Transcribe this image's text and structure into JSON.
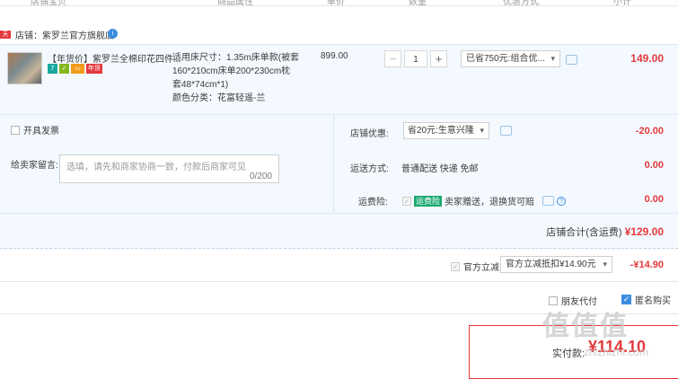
{
  "columns": [
    "店铺宝贝",
    "商品属性",
    "单价",
    "数量",
    "优惠方式",
    "小计"
  ],
  "shop": {
    "tag": "天猫",
    "label": "店铺：紫罗兰官方旗舰店",
    "badge": "i"
  },
  "item": {
    "title": "【年货价】紫罗兰全棉印花四件...",
    "icons": [
      "7",
      "✓",
      "▭",
      "年货"
    ],
    "spec_lines": [
      "适用床尺寸：1.35m床单款(被套",
      "160*210cm床单200*230cm枕",
      "套48*74cm*1)",
      "颜色分类：花富轻遥-兰"
    ],
    "unit_price": "899.00",
    "qty_minus": "−",
    "qty_value": "1",
    "qty_plus": "+",
    "promo": "已省750元:组合优...",
    "subtotal": "149.00"
  },
  "options": {
    "invoice_label": "开具发票",
    "message_label": "给卖家留言:",
    "message_placeholder": "选填，请先和商家协商一致，付款后商家可见",
    "message_count": "0/200",
    "coupon_label": "店铺优惠:",
    "coupon_value": "省20元:生意兴隆",
    "coupon_amount": "-20.00",
    "delivery_label": "运送方式:",
    "delivery_value": "普通配送 快递 免邮",
    "delivery_amount": "0.00",
    "insurance_label": "运费险:",
    "insurance_tag": "运费险",
    "insurance_value": "卖家赠送，退换货可赔",
    "insurance_amount": "0.00",
    "shop_total_label": "店铺合计(含运费)",
    "shop_total_value": "¥129.00"
  },
  "discount": {
    "label": "官方立减",
    "select_value": "官方立减抵扣¥14.90元",
    "amount": "-¥14.90"
  },
  "bottom": {
    "friend_pay": "朋友代付",
    "anonymous": "匿名购买",
    "pay_label": "实付款:",
    "pay_amount": "¥114.10",
    "watermark": "值值值",
    "watermark_url": "zhizhizhi.com"
  },
  "colors": {
    "accent_red": "#e4393c",
    "light_blue_bg": "#f3f9fe",
    "blue": "#3b8de0"
  }
}
